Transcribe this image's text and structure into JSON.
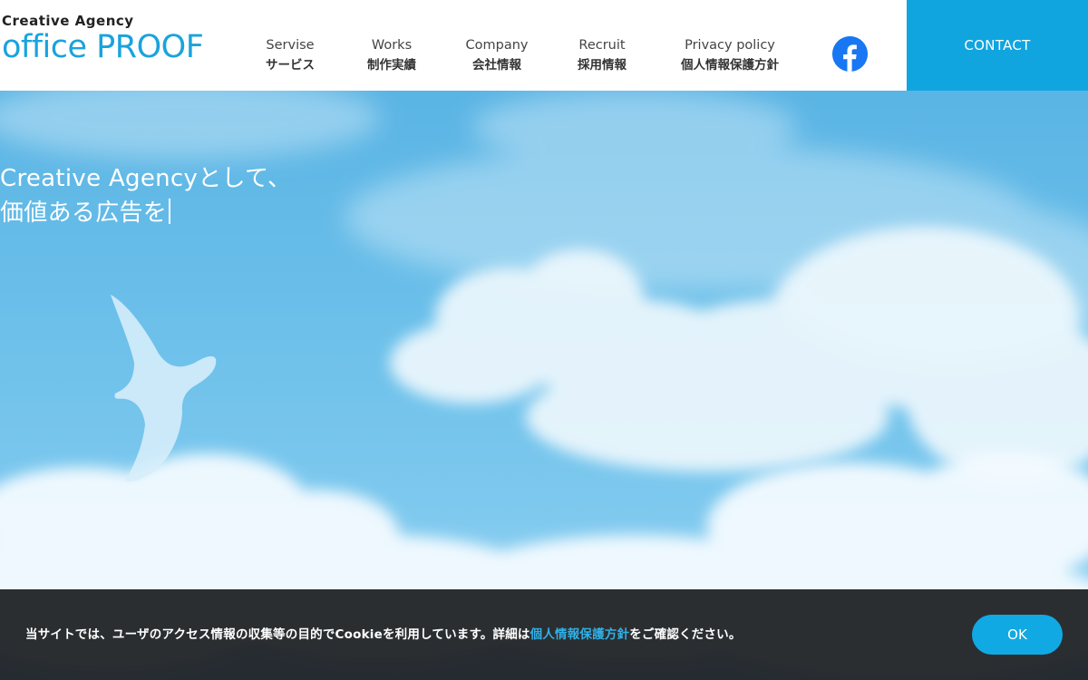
{
  "header": {
    "logo_sub": "Creative Agency",
    "logo_main": "office PROOF",
    "nav": [
      {
        "en": "Servise",
        "ja": "サービス"
      },
      {
        "en": "Works",
        "ja": "制作実績"
      },
      {
        "en": "Company",
        "ja": "会社情報"
      },
      {
        "en": "Recruit",
        "ja": "採用情報"
      },
      {
        "en": "Privacy policy",
        "ja": "個人情報保護方針"
      }
    ],
    "facebook_icon": "facebook-icon",
    "contact_label": "CONTACT"
  },
  "hero": {
    "line1": "Creative Agencyとして、",
    "line2": "価値ある広告を"
  },
  "cookie": {
    "text_before": "当サイトでは、ユーザのアクセス情報の収集等の目的でCookieを利用しています。詳細は",
    "link_text": "個人情報保護方針",
    "text_after": "をご確認ください。",
    "ok_label": "OK"
  },
  "colors": {
    "brand": "#1aa3dd",
    "contact_bg": "#10a5df",
    "cookie_bg": "#1c1e21",
    "link": "#2fb0e6"
  }
}
